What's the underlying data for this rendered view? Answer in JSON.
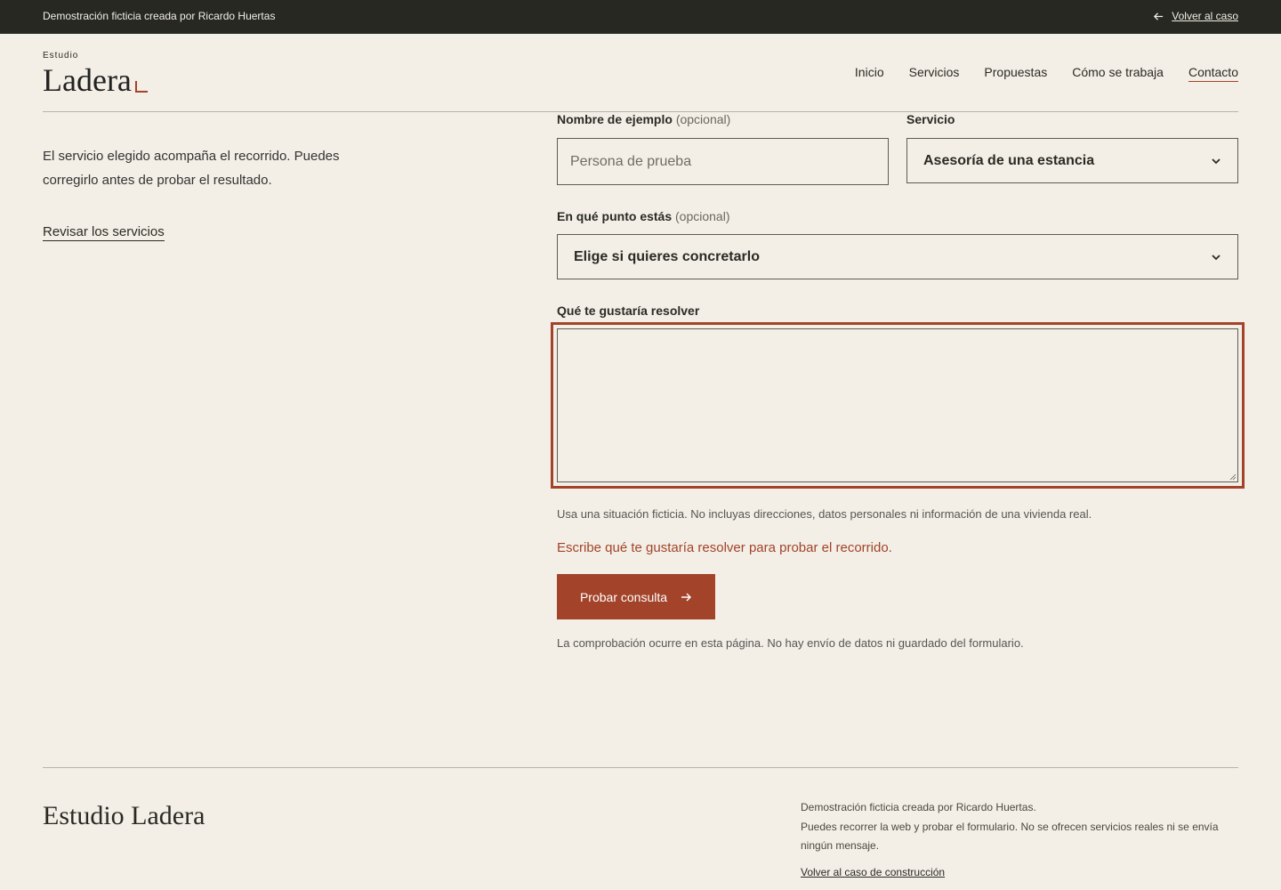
{
  "topbar": {
    "demo_text": "Demostración ficticia creada por Ricardo Huertas",
    "back_label": "Volver al caso"
  },
  "header": {
    "logo_small": "Estudio",
    "logo_big": "Ladera",
    "nav": [
      {
        "label": "Inicio"
      },
      {
        "label": "Servicios"
      },
      {
        "label": "Propuestas"
      },
      {
        "label": "Cómo se trabaja"
      },
      {
        "label": "Contacto",
        "active": true
      }
    ]
  },
  "intro": {
    "text": "El servicio elegido acompaña el recorrido. Puedes corregirlo antes de probar el resultado.",
    "link": "Revisar los servicios"
  },
  "form": {
    "name_label": "Nombre de ejemplo",
    "name_optional": "(opcional)",
    "name_placeholder": "Persona de prueba",
    "service_label": "Servicio",
    "service_value": "Asesoría de una estancia",
    "stage_label": "En qué punto estás",
    "stage_optional": "(opcional)",
    "stage_value": "Elige si quieres concretarlo",
    "message_label": "Qué te gustaría resolver",
    "message_value": "",
    "hint": "Usa una situación ficticia. No incluyas direcciones, datos personales ni información de una vivienda real.",
    "error": "Escribe qué te gustaría resolver para probar el recorrido.",
    "submit_label": "Probar consulta",
    "note": "La comprobación ocurre en esta página. No hay envío de datos ni guardado del formulario."
  },
  "footer": {
    "brand": "Estudio Ladera",
    "line1": "Demostración ficticia creada por Ricardo Huertas.",
    "line2": "Puedes recorrer la web y probar el formulario. No se ofrecen servicios reales ni se envía ningún mensaje.",
    "link": "Volver al caso de construcción"
  },
  "colors": {
    "background": "#f3efe6",
    "topbar": "#262821",
    "accent": "#a2432a"
  },
  "icons": {
    "back": "arrow-left-icon",
    "submit": "arrow-right-icon",
    "select": "chevron-down-icon"
  }
}
